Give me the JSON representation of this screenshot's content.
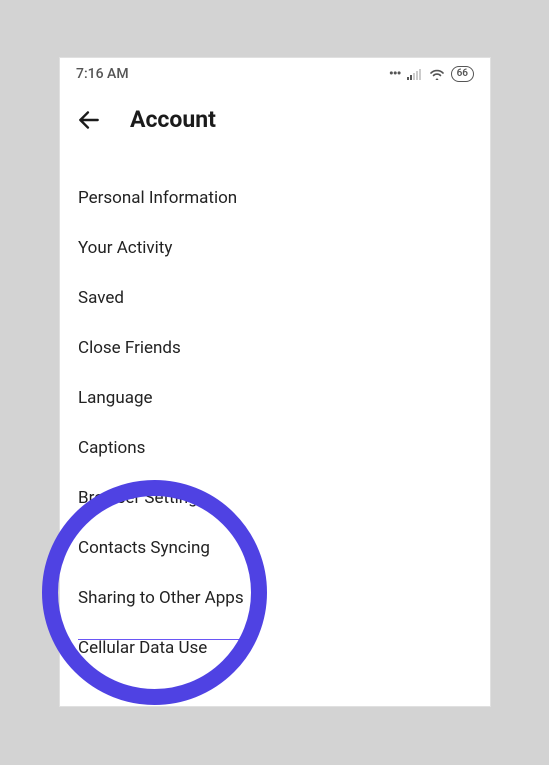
{
  "status": {
    "time": "7:16 AM",
    "battery": "66"
  },
  "header": {
    "title": "Account"
  },
  "menu": {
    "items": [
      {
        "label": "Personal Information"
      },
      {
        "label": "Your Activity"
      },
      {
        "label": "Saved"
      },
      {
        "label": "Close Friends"
      },
      {
        "label": "Language"
      },
      {
        "label": "Captions"
      },
      {
        "label": "Browser Settings"
      },
      {
        "label": "Contacts Syncing"
      },
      {
        "label": "Sharing to Other Apps"
      },
      {
        "label": "Cellular Data Use"
      }
    ]
  }
}
